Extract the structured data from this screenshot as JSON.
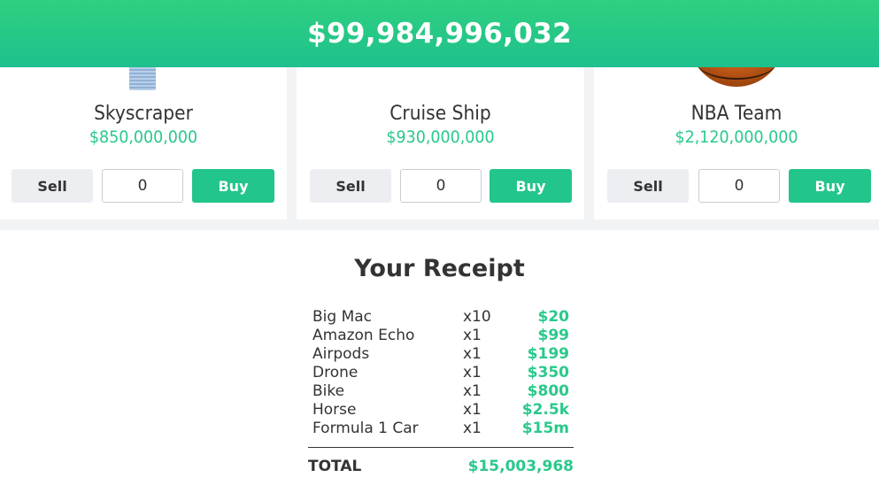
{
  "header": {
    "balance": "$99,984,996,032"
  },
  "products": [
    {
      "name": "Skyscraper",
      "price": "$850,000,000",
      "sell_label": "Sell",
      "quantity": "0",
      "buy_label": "Buy",
      "image": "skyscraper-image"
    },
    {
      "name": "Cruise Ship",
      "price": "$930,000,000",
      "sell_label": "Sell",
      "quantity": "0",
      "buy_label": "Buy",
      "image": "cruise-ship-image"
    },
    {
      "name": "NBA Team",
      "price": "$2,120,000,000",
      "sell_label": "Sell",
      "quantity": "0",
      "buy_label": "Buy",
      "image": "basketball-image"
    }
  ],
  "receipt": {
    "title": "Your Receipt",
    "items": [
      {
        "name": "Big Mac",
        "qty": "x10",
        "cost": "$20"
      },
      {
        "name": "Amazon Echo",
        "qty": "x1",
        "cost": "$99"
      },
      {
        "name": "Airpods",
        "qty": "x1",
        "cost": "$199"
      },
      {
        "name": "Drone",
        "qty": "x1",
        "cost": "$350"
      },
      {
        "name": "Bike",
        "qty": "x1",
        "cost": "$800"
      },
      {
        "name": "Horse",
        "qty": "x1",
        "cost": "$2.5k"
      },
      {
        "name": "Formula 1 Car",
        "qty": "x1",
        "cost": "$15m"
      }
    ],
    "total_label": "TOTAL",
    "total_value": "$15,003,968"
  },
  "colors": {
    "accent": "#22c58a",
    "banner": "#2fd07f",
    "background": "#f2f3f5"
  }
}
